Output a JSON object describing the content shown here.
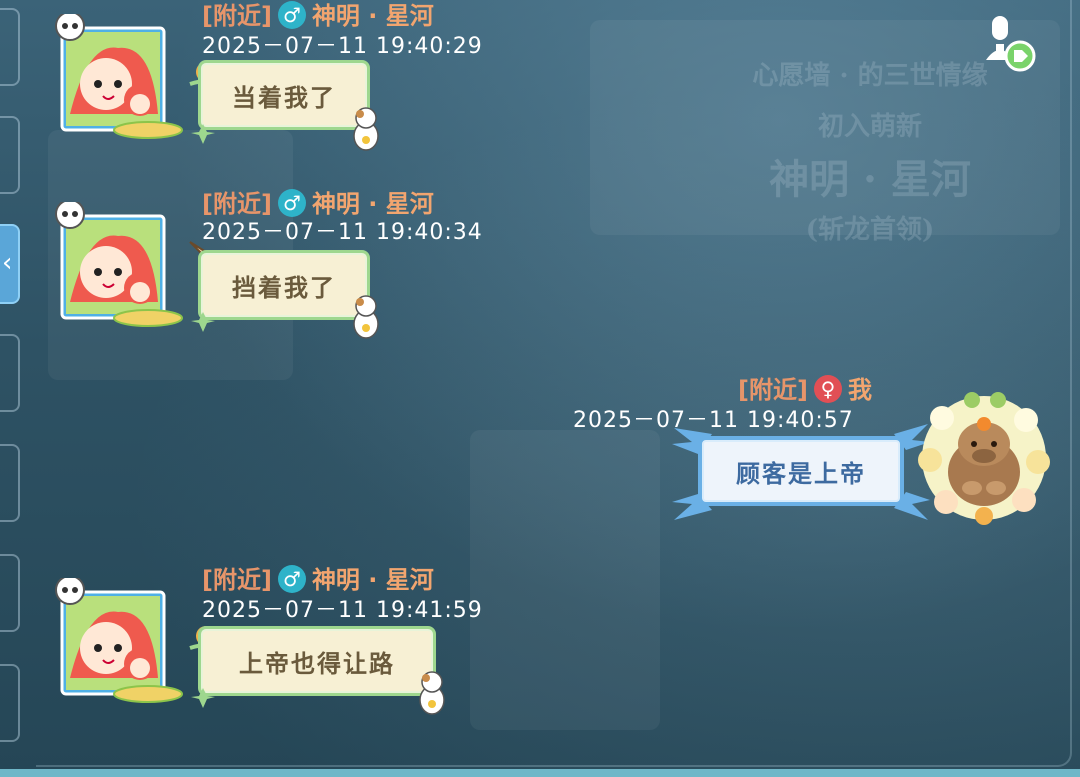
{
  "background": {
    "sign_line1": "心愿墙 · 的三世情缘",
    "sign_line2": "初入萌新",
    "sign_line3": "神明 · 星河",
    "sign_line4": "(斩龙首领)"
  },
  "icons": {
    "voice": "microphone-user-icon",
    "male": "♂",
    "female": "♀"
  },
  "messages": [
    {
      "channel": "[附近]",
      "sender": "神明 · 星河",
      "gender": "male",
      "timestamp": "2025－07－11   19:40:29",
      "text": "当着我了",
      "side": "left"
    },
    {
      "channel": "[附近]",
      "sender": "神明 · 星河",
      "gender": "male",
      "timestamp": "2025－07－11   19:40:34",
      "text": "挡着我了",
      "side": "left"
    },
    {
      "channel": "[附近]",
      "sender": "我",
      "gender": "female",
      "timestamp": "2025－07－11   19:40:57",
      "text": "顾客是上帝",
      "side": "right"
    },
    {
      "channel": "[附近]",
      "sender": "神明 · 星河",
      "gender": "male",
      "timestamp": "2025－07－11   19:41:59",
      "text": "上帝也得让路",
      "side": "left"
    }
  ],
  "colors": {
    "channel": "#e7956a",
    "male": "#2eb3c9",
    "female": "#e14f55",
    "bubble_left": "#f7f0d4",
    "bubble_right": "#eef4fb"
  }
}
